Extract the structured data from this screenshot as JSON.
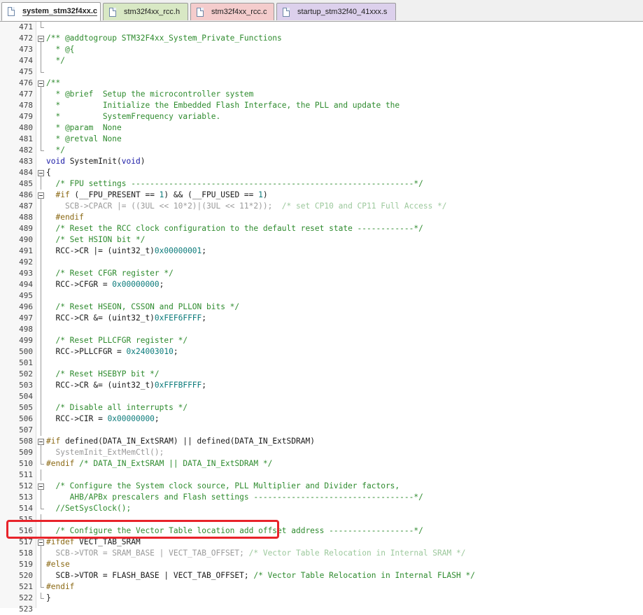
{
  "tabs": [
    {
      "label": "system_stm32f4xx.c",
      "active": true,
      "color": "#ffffff"
    },
    {
      "label": "stm32f4xx_rcc.h",
      "active": false,
      "color": "#d8e8c4"
    },
    {
      "label": "stm32f4xx_rcc.c",
      "active": false,
      "color": "#f4cccc"
    },
    {
      "label": "startup_stm32f40_41xxx.s",
      "active": false,
      "color": "#dcd0ec"
    }
  ],
  "colors": {
    "highlight": "#e8232a",
    "comment": "#2e8b2e",
    "keyword": "#1a1aa6",
    "number": "#0a7a7a"
  },
  "lines": [
    {
      "n": "471",
      "f": "end",
      "t": []
    },
    {
      "n": "472",
      "f": "box",
      "t": [
        [
          "c",
          "/** @addtogroup STM32F4xx_System_Private_Functions"
        ]
      ]
    },
    {
      "n": "473",
      "f": "line",
      "t": [
        [
          "c",
          "  * @{"
        ]
      ]
    },
    {
      "n": "474",
      "f": "line",
      "t": [
        [
          "c",
          "  */"
        ]
      ]
    },
    {
      "n": "475",
      "f": "end",
      "t": []
    },
    {
      "n": "476",
      "f": "box",
      "t": [
        [
          "c",
          "/**"
        ]
      ]
    },
    {
      "n": "477",
      "f": "line",
      "t": [
        [
          "c",
          "  * @brief  Setup the microcontroller system"
        ]
      ]
    },
    {
      "n": "478",
      "f": "line",
      "t": [
        [
          "c",
          "  *         Initialize the Embedded Flash Interface, the PLL and update the"
        ]
      ]
    },
    {
      "n": "479",
      "f": "line",
      "t": [
        [
          "c",
          "  *         SystemFrequency variable."
        ]
      ]
    },
    {
      "n": "480",
      "f": "line",
      "t": [
        [
          "c",
          "  * @param  None"
        ]
      ]
    },
    {
      "n": "481",
      "f": "line",
      "t": [
        [
          "c",
          "  * @retval None"
        ]
      ]
    },
    {
      "n": "482",
      "f": "end",
      "t": [
        [
          "c",
          "  */"
        ]
      ]
    },
    {
      "n": "483",
      "f": "",
      "t": [
        [
          "kw",
          "void"
        ],
        [
          "tx",
          " SystemInit("
        ],
        [
          "kw",
          "void"
        ],
        [
          "tx",
          ")"
        ]
      ]
    },
    {
      "n": "484",
      "f": "box",
      "t": [
        [
          "tx",
          "{"
        ]
      ]
    },
    {
      "n": "485",
      "f": "line",
      "t": [
        [
          "c",
          "  /* FPU settings ------------------------------------------------------------*/"
        ]
      ]
    },
    {
      "n": "486",
      "f": "box",
      "t": [
        [
          "pp",
          "  #if "
        ],
        [
          "tx",
          "(__FPU_PRESENT == "
        ],
        [
          "num",
          "1"
        ],
        [
          "tx",
          ") && (__FPU_USED == "
        ],
        [
          "num",
          "1"
        ],
        [
          "tx",
          ")"
        ]
      ]
    },
    {
      "n": "487",
      "f": "line",
      "t": [
        [
          "dim",
          "    SCB->CPACR |= ((3UL << 10*2)|(3UL << 11*2));  "
        ],
        [
          "dimc",
          "/* set CP10 and CP11 Full Access */"
        ]
      ]
    },
    {
      "n": "488",
      "f": "line",
      "t": [
        [
          "pp",
          "  #endif"
        ]
      ]
    },
    {
      "n": "489",
      "f": "line",
      "t": [
        [
          "c",
          "  /* Reset the RCC clock configuration to the default reset state ------------*/"
        ]
      ]
    },
    {
      "n": "490",
      "f": "line",
      "t": [
        [
          "c",
          "  /* Set HSION bit */"
        ]
      ]
    },
    {
      "n": "491",
      "f": "line",
      "t": [
        [
          "tx",
          "  RCC->CR |= (uint32_t)"
        ],
        [
          "num",
          "0x00000001"
        ],
        [
          "tx",
          ";"
        ]
      ]
    },
    {
      "n": "492",
      "f": "line",
      "t": []
    },
    {
      "n": "493",
      "f": "line",
      "t": [
        [
          "c",
          "  /* Reset CFGR register */"
        ]
      ]
    },
    {
      "n": "494",
      "f": "line",
      "t": [
        [
          "tx",
          "  RCC->CFGR = "
        ],
        [
          "num",
          "0x00000000"
        ],
        [
          "tx",
          ";"
        ]
      ]
    },
    {
      "n": "495",
      "f": "line",
      "t": []
    },
    {
      "n": "496",
      "f": "line",
      "t": [
        [
          "c",
          "  /* Reset HSEON, CSSON and PLLON bits */"
        ]
      ]
    },
    {
      "n": "497",
      "f": "line",
      "t": [
        [
          "tx",
          "  RCC->CR &= (uint32_t)"
        ],
        [
          "num",
          "0xFEF6FFFF"
        ],
        [
          "tx",
          ";"
        ]
      ]
    },
    {
      "n": "498",
      "f": "line",
      "t": []
    },
    {
      "n": "499",
      "f": "line",
      "t": [
        [
          "c",
          "  /* Reset PLLCFGR register */"
        ]
      ]
    },
    {
      "n": "500",
      "f": "line",
      "t": [
        [
          "tx",
          "  RCC->PLLCFGR = "
        ],
        [
          "num",
          "0x24003010"
        ],
        [
          "tx",
          ";"
        ]
      ]
    },
    {
      "n": "501",
      "f": "line",
      "t": []
    },
    {
      "n": "502",
      "f": "line",
      "t": [
        [
          "c",
          "  /* Reset HSEBYP bit */"
        ]
      ]
    },
    {
      "n": "503",
      "f": "line",
      "t": [
        [
          "tx",
          "  RCC->CR &= (uint32_t)"
        ],
        [
          "num",
          "0xFFFBFFFF"
        ],
        [
          "tx",
          ";"
        ]
      ]
    },
    {
      "n": "504",
      "f": "line",
      "t": []
    },
    {
      "n": "505",
      "f": "line",
      "t": [
        [
          "c",
          "  /* Disable all interrupts */"
        ]
      ]
    },
    {
      "n": "506",
      "f": "line",
      "t": [
        [
          "tx",
          "  RCC->CIR = "
        ],
        [
          "num",
          "0x00000000"
        ],
        [
          "tx",
          ";"
        ]
      ]
    },
    {
      "n": "507",
      "f": "line",
      "t": []
    },
    {
      "n": "508",
      "f": "box",
      "t": [
        [
          "pp",
          "#if "
        ],
        [
          "tx",
          "defined(DATA_IN_ExtSRAM) || defined(DATA_IN_ExtSDRAM)"
        ]
      ]
    },
    {
      "n": "509",
      "f": "line",
      "t": [
        [
          "dim",
          "  SystemInit_ExtMemCtl();"
        ]
      ]
    },
    {
      "n": "510",
      "f": "end",
      "t": [
        [
          "pp",
          "#endif "
        ],
        [
          "c",
          "/* DATA_IN_ExtSRAM || DATA_IN_ExtSDRAM */"
        ]
      ]
    },
    {
      "n": "511",
      "f": "line",
      "t": []
    },
    {
      "n": "512",
      "f": "box",
      "t": [
        [
          "c",
          "  /* Configure the System clock source, PLL Multiplier and Divider factors,"
        ]
      ]
    },
    {
      "n": "513",
      "f": "line",
      "t": [
        [
          "c",
          "     AHB/APBx prescalers and Flash settings ----------------------------------*/"
        ]
      ]
    },
    {
      "n": "514",
      "f": "end",
      "t": [
        [
          "c",
          "  //SetSysClock();"
        ]
      ]
    },
    {
      "n": "515",
      "f": "line",
      "t": []
    },
    {
      "n": "516",
      "f": "line",
      "t": [
        [
          "c",
          "  /* Configure the Vector Table location add offset address ------------------*/"
        ]
      ]
    },
    {
      "n": "517",
      "f": "box",
      "t": [
        [
          "pp",
          "#ifdef "
        ],
        [
          "tx",
          "VECT_TAB_SRAM"
        ]
      ]
    },
    {
      "n": "518",
      "f": "line",
      "t": [
        [
          "dim",
          "  SCB->VTOR = SRAM_BASE | VECT_TAB_OFFSET; "
        ],
        [
          "dimc",
          "/* Vector Table Relocation in Internal SRAM */"
        ]
      ]
    },
    {
      "n": "519",
      "f": "line",
      "t": [
        [
          "pp",
          "#else"
        ]
      ]
    },
    {
      "n": "520",
      "f": "line",
      "t": [
        [
          "tx",
          "  SCB->VTOR = FLASH_BASE | VECT_TAB_OFFSET; "
        ],
        [
          "c",
          "/* Vector Table Relocation in Internal FLASH */"
        ]
      ]
    },
    {
      "n": "521",
      "f": "end",
      "t": [
        [
          "pp",
          "#endif"
        ]
      ]
    },
    {
      "n": "522",
      "f": "end",
      "t": [
        [
          "tx",
          "}"
        ]
      ]
    },
    {
      "n": "523",
      "f": "",
      "t": []
    }
  ]
}
